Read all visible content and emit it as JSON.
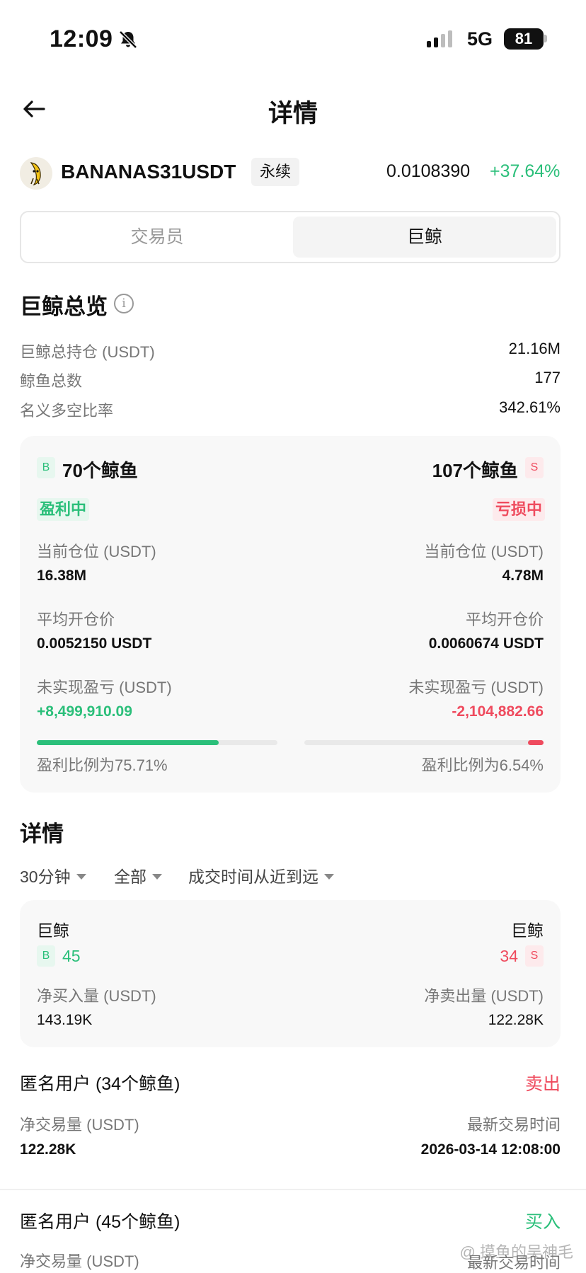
{
  "status_bar": {
    "time": "12:09",
    "network": "5G",
    "battery": "81"
  },
  "header": {
    "title": "详情"
  },
  "symbol": {
    "name": "BANANAS31USDT",
    "type": "永续",
    "price": "0.0108390",
    "change": "+37.64%"
  },
  "tabs": [
    {
      "label": "交易员"
    },
    {
      "label": "巨鲸"
    }
  ],
  "overview": {
    "title": "巨鲸总览",
    "rows": [
      {
        "label": "巨鲸总持仓 (USDT)",
        "value": "21.16M"
      },
      {
        "label": "鲸鱼总数",
        "value": "177"
      },
      {
        "label": "名义多空比率",
        "value": "342.61%"
      }
    ]
  },
  "long_short": {
    "long": {
      "badge": "B",
      "count": "70个鲸鱼",
      "status": "盈利中",
      "position_label": "当前仓位 (USDT)",
      "position": "16.38M",
      "avg_label": "平均开仓价",
      "avg": "0.0052150 USDT",
      "pnl_label": "未实现盈亏 (USDT)",
      "pnl": "+8,499,910.09",
      "ratio_label": "盈利比例为75.71%",
      "ratio": 0.7571
    },
    "short": {
      "badge": "S",
      "count": "107个鲸鱼",
      "status": "亏损中",
      "position_label": "当前仓位 (USDT)",
      "position": "4.78M",
      "avg_label": "平均开仓价",
      "avg": "0.0060674 USDT",
      "pnl_label": "未实现盈亏 (USDT)",
      "pnl": "-2,104,882.66",
      "ratio_label": "盈利比例为6.54%",
      "ratio": 0.0654
    }
  },
  "details": {
    "title": "详情",
    "filters": [
      {
        "label": "30分钟"
      },
      {
        "label": "全部"
      },
      {
        "label": "成交时间从近到远"
      }
    ],
    "summary": {
      "left_title": "巨鲸",
      "buy_badge": "B",
      "buy_count": "45",
      "right_title": "巨鲸",
      "sell_badge": "S",
      "sell_count": "34",
      "net_buy_label": "净买入量 (USDT)",
      "net_buy": "143.19K",
      "net_sell_label": "净卖出量 (USDT)",
      "net_sell": "122.28K"
    },
    "items": [
      {
        "user": "匿名用户 (34个鲸鱼)",
        "side": "卖出",
        "net_label": "净交易量 (USDT)",
        "net": "122.28K",
        "time_label": "最新交易时间",
        "time": "2026-03-14 12:08:00"
      },
      {
        "user": "匿名用户 (45个鲸鱼)",
        "side": "买入",
        "net_label": "净交易量 (USDT)",
        "time_label": "最新交易时间"
      }
    ]
  },
  "watermark": "@ 摸鱼的吴神毛",
  "colors": {
    "green": "#2bbf7a",
    "red": "#ef4b5e",
    "card": "#f8f8f8"
  }
}
